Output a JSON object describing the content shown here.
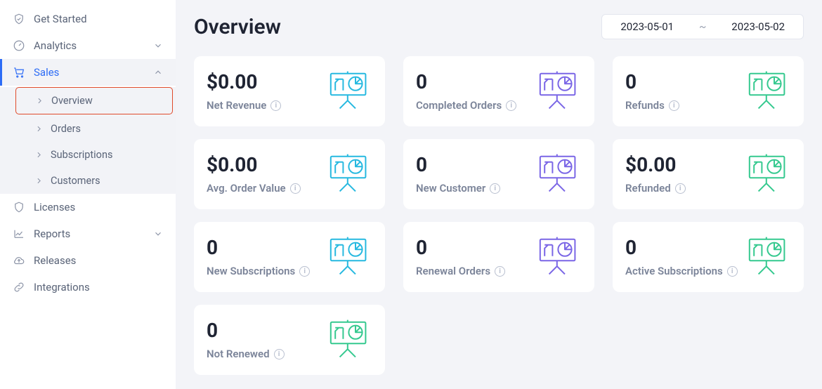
{
  "sidebar": {
    "items": [
      {
        "label": "Get Started"
      },
      {
        "label": "Analytics"
      },
      {
        "label": "Sales"
      },
      {
        "label": "Licenses"
      },
      {
        "label": "Reports"
      },
      {
        "label": "Releases"
      },
      {
        "label": "Integrations"
      }
    ],
    "sales_submenu": [
      {
        "label": "Overview"
      },
      {
        "label": "Orders"
      },
      {
        "label": "Subscriptions"
      },
      {
        "label": "Customers"
      }
    ]
  },
  "header": {
    "title": "Overview",
    "date_start": "2023-05-01",
    "date_sep": "~",
    "date_end": "2023-05-02"
  },
  "cards": [
    {
      "value": "$0.00",
      "label": "Net Revenue",
      "color": "#27b9e0"
    },
    {
      "value": "0",
      "label": "Completed Orders",
      "color": "#7a66e6"
    },
    {
      "value": "0",
      "label": "Refunds",
      "color": "#35c98f"
    },
    {
      "value": "$0.00",
      "label": "Avg. Order Value",
      "color": "#27b9e0"
    },
    {
      "value": "0",
      "label": "New Customer",
      "color": "#7a66e6"
    },
    {
      "value": "$0.00",
      "label": "Refunded",
      "color": "#35c98f"
    },
    {
      "value": "0",
      "label": "New Subscriptions",
      "color": "#27b9e0"
    },
    {
      "value": "0",
      "label": "Renewal Orders",
      "color": "#7a66e6"
    },
    {
      "value": "0",
      "label": "Active Subscriptions",
      "color": "#35c98f"
    },
    {
      "value": "0",
      "label": "Not Renewed",
      "color": "#35c98f"
    }
  ]
}
